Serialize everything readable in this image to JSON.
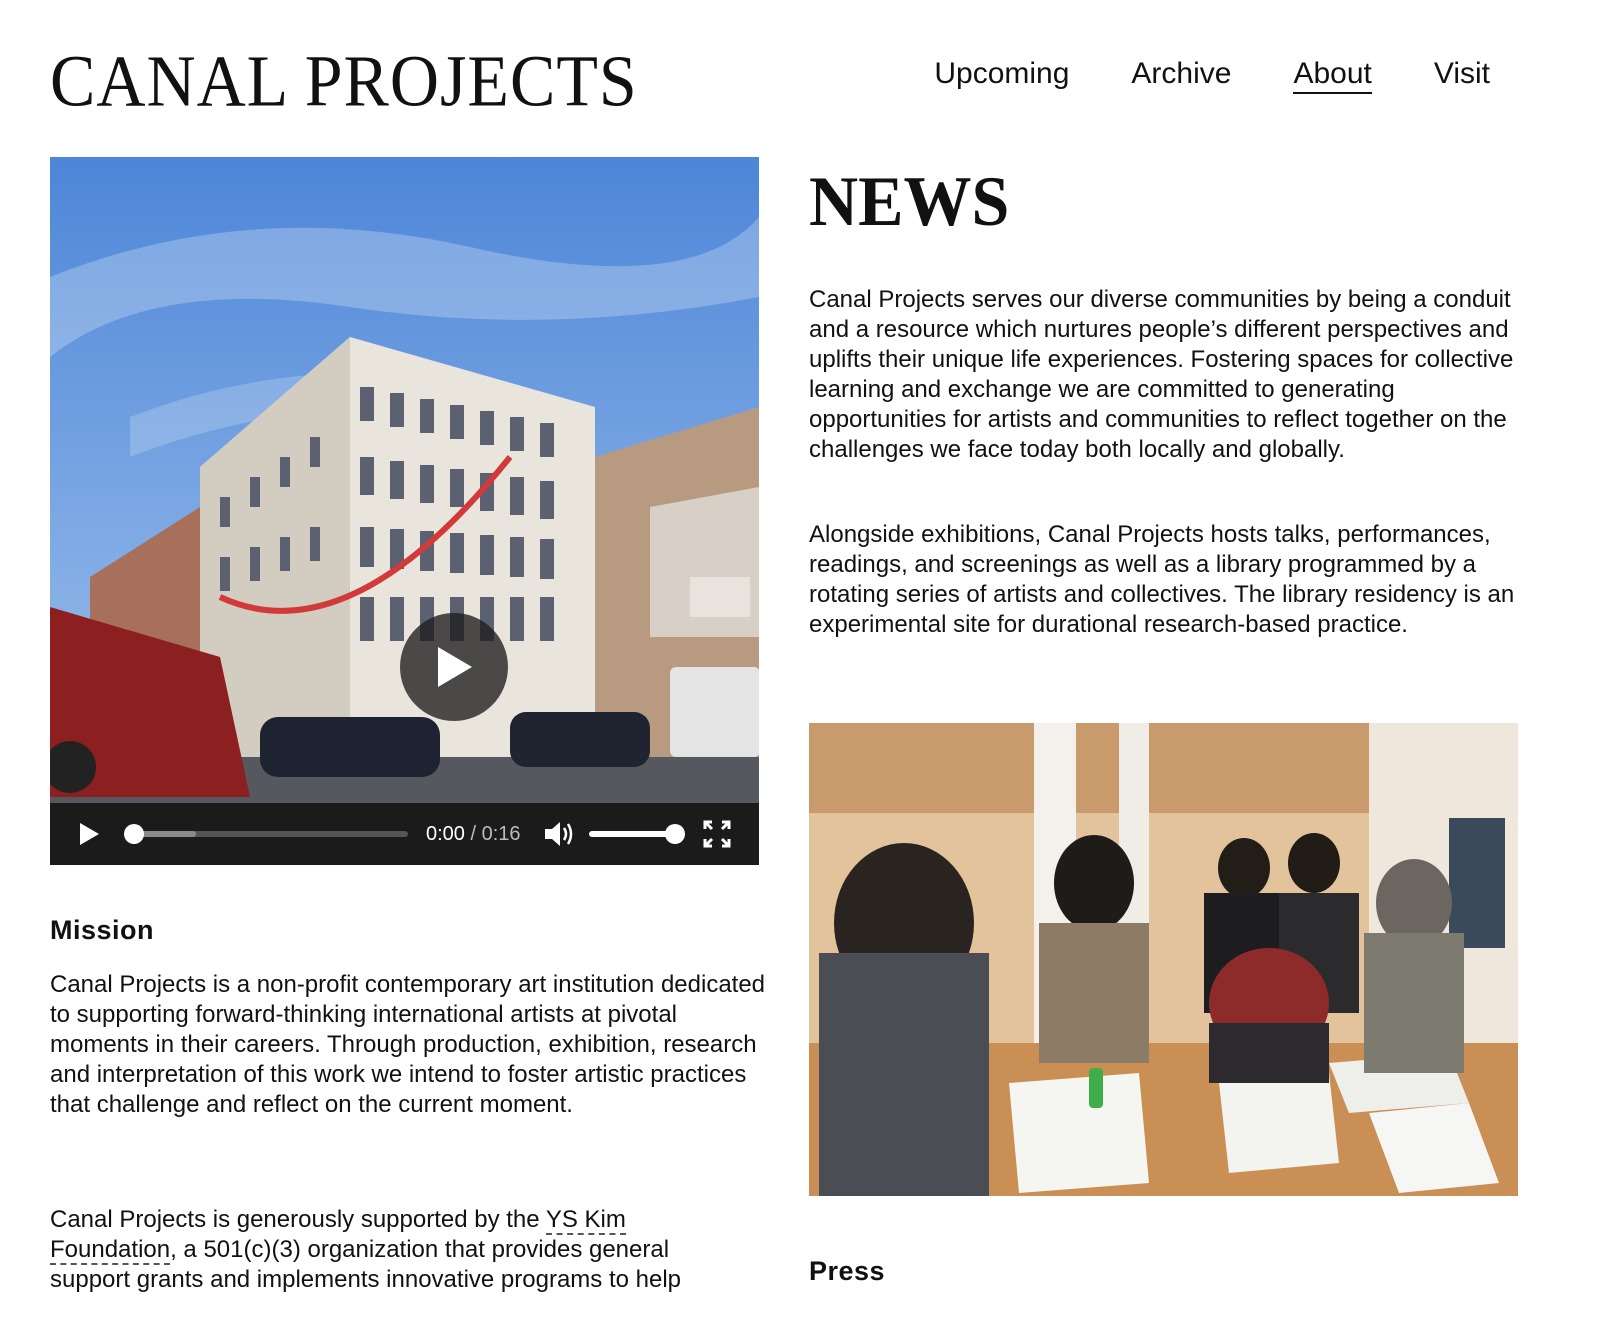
{
  "header": {
    "logo": "CANAL PROJECTS",
    "nav": [
      {
        "label": "Upcoming",
        "active": false
      },
      {
        "label": "Archive",
        "active": false
      },
      {
        "label": "About",
        "active": true
      },
      {
        "label": "Visit",
        "active": false
      }
    ]
  },
  "video": {
    "current_time": "0:00",
    "separator": " / ",
    "duration": "0:16",
    "volume_level": 1.0,
    "progress_fraction": 0.0
  },
  "mission": {
    "heading": "Mission",
    "text": "Canal Projects is a non-profit contemporary art institution dedicated to supporting forward-thinking international artists at pivotal moments in their careers. Through production, exhibition, research and interpretation of this work we intend to foster artistic practices that challenge and reflect on the current moment."
  },
  "support": {
    "before": "Canal Projects is generously supported by the ",
    "link": "YS Kim Foundation",
    "after": ", a 501(c)(3) organization that provides general support grants and implements innovative programs to help"
  },
  "news": {
    "heading": "NEWS",
    "paragraph1": "Canal Projects serves our diverse communities by being a conduit and a resource which nurtures people’s different perspectives and uplifts their unique life experiences. Fostering spaces for collective learning and exchange we are committed to generating opportunities for artists and communities to reflect together on the challenges we face today both locally and globally.",
    "paragraph2": "Alongside exhibitions, Canal Projects hosts talks, performances, readings, and screenings as well as a library programmed by a rotating series of artists and collectives. The library residency is an experimental site for durational research-based practice."
  },
  "press": {
    "heading": "Press"
  },
  "colors": {
    "text": "#111111",
    "background": "#ffffff",
    "video_controls": "#1b1b1b"
  },
  "icons": [
    "play-icon",
    "volume-icon",
    "fullscreen-icon"
  ]
}
